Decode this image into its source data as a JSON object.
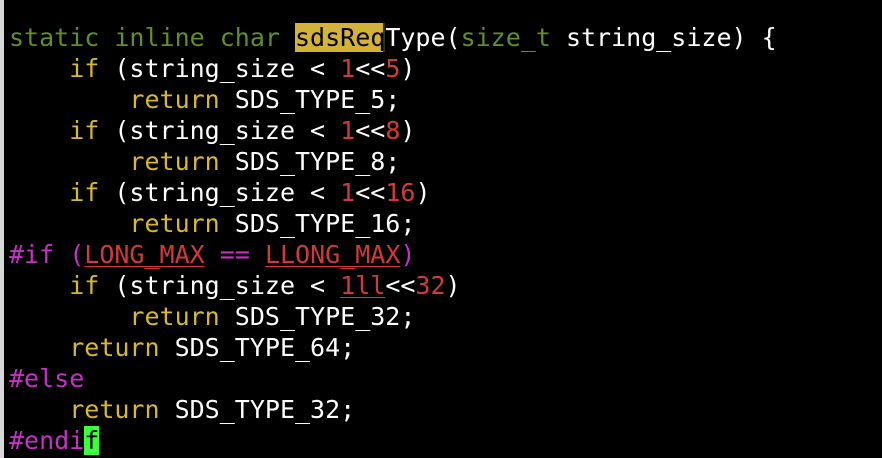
{
  "editor": {
    "lines": [
      [
        {
          "t": "static inline char ",
          "k": "keyword"
        },
        {
          "t": "sdsRe",
          "k": "search"
        },
        {
          "t": "q",
          "k": "search-cursor"
        },
        {
          "t": "Type(",
          "k": "text"
        },
        {
          "t": "size_t",
          "k": "keyword"
        },
        {
          "t": " string_size) {",
          "k": "text"
        }
      ],
      [
        {
          "t": "    ",
          "k": "text"
        },
        {
          "t": "if",
          "k": "control"
        },
        {
          "t": " (string_size < ",
          "k": "text"
        },
        {
          "t": "1",
          "k": "number"
        },
        {
          "t": "<<",
          "k": "text"
        },
        {
          "t": "5",
          "k": "number"
        },
        {
          "t": ")",
          "k": "text"
        }
      ],
      [
        {
          "t": "        ",
          "k": "text"
        },
        {
          "t": "return",
          "k": "control"
        },
        {
          "t": " SDS_TYPE_5;",
          "k": "text"
        }
      ],
      [
        {
          "t": "    ",
          "k": "text"
        },
        {
          "t": "if",
          "k": "control"
        },
        {
          "t": " (string_size < ",
          "k": "text"
        },
        {
          "t": "1",
          "k": "number"
        },
        {
          "t": "<<",
          "k": "text"
        },
        {
          "t": "8",
          "k": "number"
        },
        {
          "t": ")",
          "k": "text"
        }
      ],
      [
        {
          "t": "        ",
          "k": "text"
        },
        {
          "t": "return",
          "k": "control"
        },
        {
          "t": " SDS_TYPE_8;",
          "k": "text"
        }
      ],
      [
        {
          "t": "    ",
          "k": "text"
        },
        {
          "t": "if",
          "k": "control"
        },
        {
          "t": " (string_size < ",
          "k": "text"
        },
        {
          "t": "1",
          "k": "number"
        },
        {
          "t": "<<",
          "k": "text"
        },
        {
          "t": "16",
          "k": "number"
        },
        {
          "t": ")",
          "k": "text"
        }
      ],
      [
        {
          "t": "        ",
          "k": "text"
        },
        {
          "t": "return",
          "k": "control"
        },
        {
          "t": " SDS_TYPE_16;",
          "k": "text"
        }
      ],
      [
        {
          "t": "#if ",
          "k": "preproc"
        },
        {
          "t": "(",
          "k": "preproc"
        },
        {
          "t": "LONG_MAX",
          "k": "number-u"
        },
        {
          "t": " ",
          "k": "text"
        },
        {
          "t": "==",
          "k": "preproc"
        },
        {
          "t": " ",
          "k": "text"
        },
        {
          "t": "LLONG_MAX",
          "k": "number-u"
        },
        {
          "t": ")",
          "k": "preproc"
        }
      ],
      [
        {
          "t": "    ",
          "k": "text"
        },
        {
          "t": "if",
          "k": "control"
        },
        {
          "t": " (string_size < ",
          "k": "text"
        },
        {
          "t": "1ll",
          "k": "number-u"
        },
        {
          "t": "<<",
          "k": "text"
        },
        {
          "t": "32",
          "k": "number"
        },
        {
          "t": ")",
          "k": "text"
        }
      ],
      [
        {
          "t": "        ",
          "k": "text"
        },
        {
          "t": "return",
          "k": "control"
        },
        {
          "t": " SDS_TYPE_32;",
          "k": "text"
        }
      ],
      [
        {
          "t": "    ",
          "k": "text"
        },
        {
          "t": "return",
          "k": "control"
        },
        {
          "t": " SDS_TYPE_64;",
          "k": "text"
        }
      ],
      [
        {
          "t": "#else",
          "k": "preproc"
        }
      ],
      [
        {
          "t": "    ",
          "k": "text"
        },
        {
          "t": "return",
          "k": "control"
        },
        {
          "t": " SDS_TYPE_32;",
          "k": "text"
        }
      ],
      [
        {
          "t": "#endi",
          "k": "preproc"
        },
        {
          "t": "f",
          "k": "cursor"
        }
      ]
    ],
    "colors": {
      "background": "#000000",
      "keyword": "#5f8f2a",
      "control": "#d7b830",
      "number": "#d23a3a",
      "preproc": "#c531c5",
      "search_highlight": "#d4b237",
      "cursor": "#3cff3c"
    }
  }
}
